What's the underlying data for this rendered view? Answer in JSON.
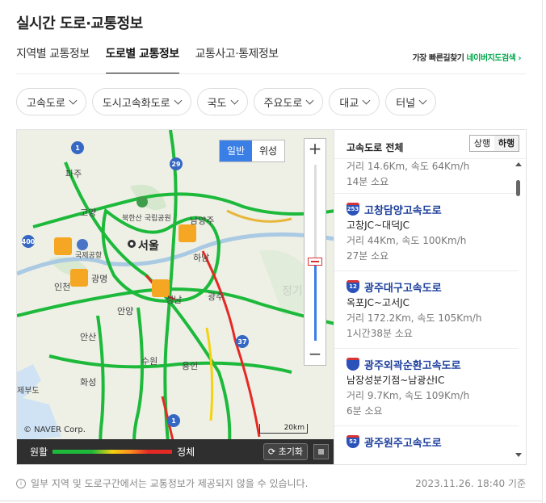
{
  "title": "실시간 도로·교통정보",
  "tabs": [
    "지역별 교통정보",
    "도로별 교통정보",
    "교통사고·통제정보"
  ],
  "navi": {
    "label": "가장 빠른길찾기",
    "link": "네이버지도검색 ›"
  },
  "chips": [
    "고속도로",
    "도시고속화도로",
    "국도",
    "주요도로",
    "대교",
    "터널"
  ],
  "map": {
    "map_types": [
      "일반",
      "위성"
    ],
    "zoom_in": "+",
    "zoom_out": "−",
    "zoom_level": 0.45,
    "copyright": "© NAVER Corp.",
    "scale": "20km",
    "places": [
      "파주",
      "고양",
      "북한산 국립공원",
      "남양주",
      "서울",
      "하남",
      "국제공항",
      "인천",
      "광명",
      "성남",
      "광주",
      "안양",
      "수원",
      "용인",
      "안산",
      "화성",
      "제부도",
      "정기"
    ],
    "road_signs": [
      "1",
      "29",
      "400",
      "37",
      "1"
    ],
    "legend": {
      "low": "원활",
      "high": "정체",
      "reset": "초기화"
    },
    "colors": {
      "smooth": "#1db93b",
      "slow": "#f4d20f",
      "jam": "#e52a25",
      "road_main": "#ffffff"
    }
  },
  "list": {
    "title": "고속도로 전체",
    "directions": [
      "상행",
      "하행"
    ],
    "first_partial": {
      "meta1": "거리 14.6Km, 속도 64Km/h",
      "meta2": "14분 소요"
    },
    "items": [
      {
        "num": "253",
        "name": "고창담양고속도로",
        "section": "고창JC~대덕JC",
        "meta1": "거리 44Km, 속도 100Km/h",
        "meta2": "27분 소요"
      },
      {
        "num": "12",
        "name": "광주대구고속도로",
        "section": "옥포JC~고서JC",
        "meta1": "거리 172.2Km, 속도 105Km/h",
        "meta2": "1시간38분 소요"
      },
      {
        "num": "",
        "name": "광주외곽순환고속도로",
        "section": "남장성분기점~남광산IC",
        "meta1": "거리 9.7Km, 속도 109Km/h",
        "meta2": "6분 소요"
      },
      {
        "num": "52",
        "name": "광주원주고속도로",
        "section": "",
        "meta1": "",
        "meta2": ""
      }
    ]
  },
  "footer": {
    "notice": "일부 지역 및 도로구간에서는 교통정보가 제공되지 않을 수 있습니다.",
    "timestamp": "2023.11.26. 18:40 기준"
  }
}
